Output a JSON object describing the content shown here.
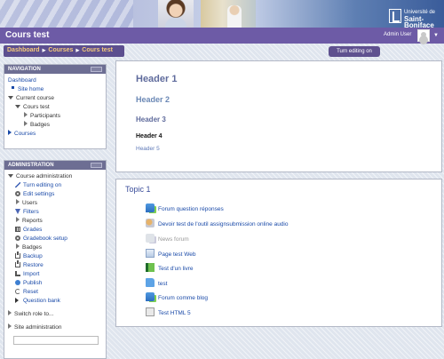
{
  "header": {
    "course_title": "Cours test",
    "user_name": "Admin User",
    "logo_line1": "Université de",
    "logo_line2": "Saint-Boniface"
  },
  "breadcrumb": [
    "Dashboard",
    "Courses",
    "Cours test"
  ],
  "turn_editing_button": "Turn editing on",
  "navigation": {
    "title": "NAVIGATION",
    "dashboard": "Dashboard",
    "site_home": "Site home",
    "current_course": "Current course",
    "course_name": "Cours test",
    "participants": "Participants",
    "badges": "Badges",
    "courses": "Courses"
  },
  "administration": {
    "title": "ADMINISTRATION",
    "course_admin": "Course administration",
    "items": [
      {
        "label": "Turn editing on",
        "icon": "pencil-icon"
      },
      {
        "label": "Edit settings",
        "icon": "gear-icon"
      },
      {
        "label": "Users",
        "icon": "chevron-right-icon"
      },
      {
        "label": "Filters",
        "icon": "filter-icon"
      },
      {
        "label": "Reports",
        "icon": "chevron-right-icon"
      },
      {
        "label": "Grades",
        "icon": "grades-icon"
      },
      {
        "label": "Gradebook setup",
        "icon": "gear-icon"
      },
      {
        "label": "Badges",
        "icon": "chevron-right-icon"
      },
      {
        "label": "Backup",
        "icon": "backup-icon"
      },
      {
        "label": "Restore",
        "icon": "restore-icon"
      },
      {
        "label": "Import",
        "icon": "import-icon"
      },
      {
        "label": "Publish",
        "icon": "publish-icon"
      },
      {
        "label": "Reset",
        "icon": "reset-icon"
      },
      {
        "label": "Question bank",
        "icon": "question-bank-icon"
      }
    ],
    "switch_role": "Switch role to...",
    "site_admin": "Site administration"
  },
  "headers_section": {
    "h1": "Header 1",
    "h2": "Header 2",
    "h3": "Header 3",
    "h4": "Header 4",
    "h5": "Header 5"
  },
  "topic": {
    "title": "Topic 1",
    "activities": [
      {
        "label": "Forum question réponses",
        "icon": "forum-icon"
      },
      {
        "label": "Devoir test de l'outil assignsubmission online audio",
        "icon": "assignment-icon"
      },
      {
        "label": "News forum",
        "icon": "news-forum-icon"
      },
      {
        "label": "Page test Web",
        "icon": "page-icon"
      },
      {
        "label": "Test d'un livre",
        "icon": "book-icon"
      },
      {
        "label": "test",
        "icon": "folder-icon"
      },
      {
        "label": "Forum comme blog",
        "icon": "forum-icon"
      },
      {
        "label": "Test HTML 5",
        "icon": "html-icon"
      }
    ]
  }
}
